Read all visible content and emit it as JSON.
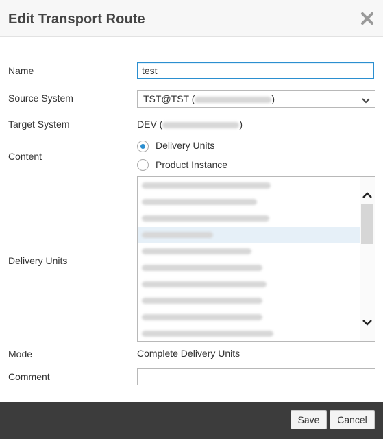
{
  "dialog": {
    "title": "Edit Transport Route"
  },
  "form": {
    "name_label": "Name",
    "name_value": "test",
    "source_label": "Source System",
    "source_value": "TST@TST (",
    "source_suffix": ")",
    "target_label": "Target System",
    "target_value": "DEV (",
    "target_suffix": ")",
    "content_label": "Content",
    "content_options": [
      {
        "label": "Delivery Units",
        "checked": true
      },
      {
        "label": "Product Instance",
        "checked": false
      }
    ],
    "delivery_units_label": "Delivery Units",
    "mode_label": "Mode",
    "mode_value": "Complete Delivery Units",
    "comment_label": "Comment",
    "comment_value": ""
  },
  "footer": {
    "save_label": "Save",
    "cancel_label": "Cancel"
  },
  "icons": {
    "close": "close-icon",
    "chevron": "chevron-down-icon",
    "scroll_up": "chevron-up-icon",
    "scroll_down": "chevron-down-icon"
  },
  "colors": {
    "accent": "#2b8fd0",
    "footer": "#3c3c3c",
    "selected_row": "#e6f0f8"
  }
}
